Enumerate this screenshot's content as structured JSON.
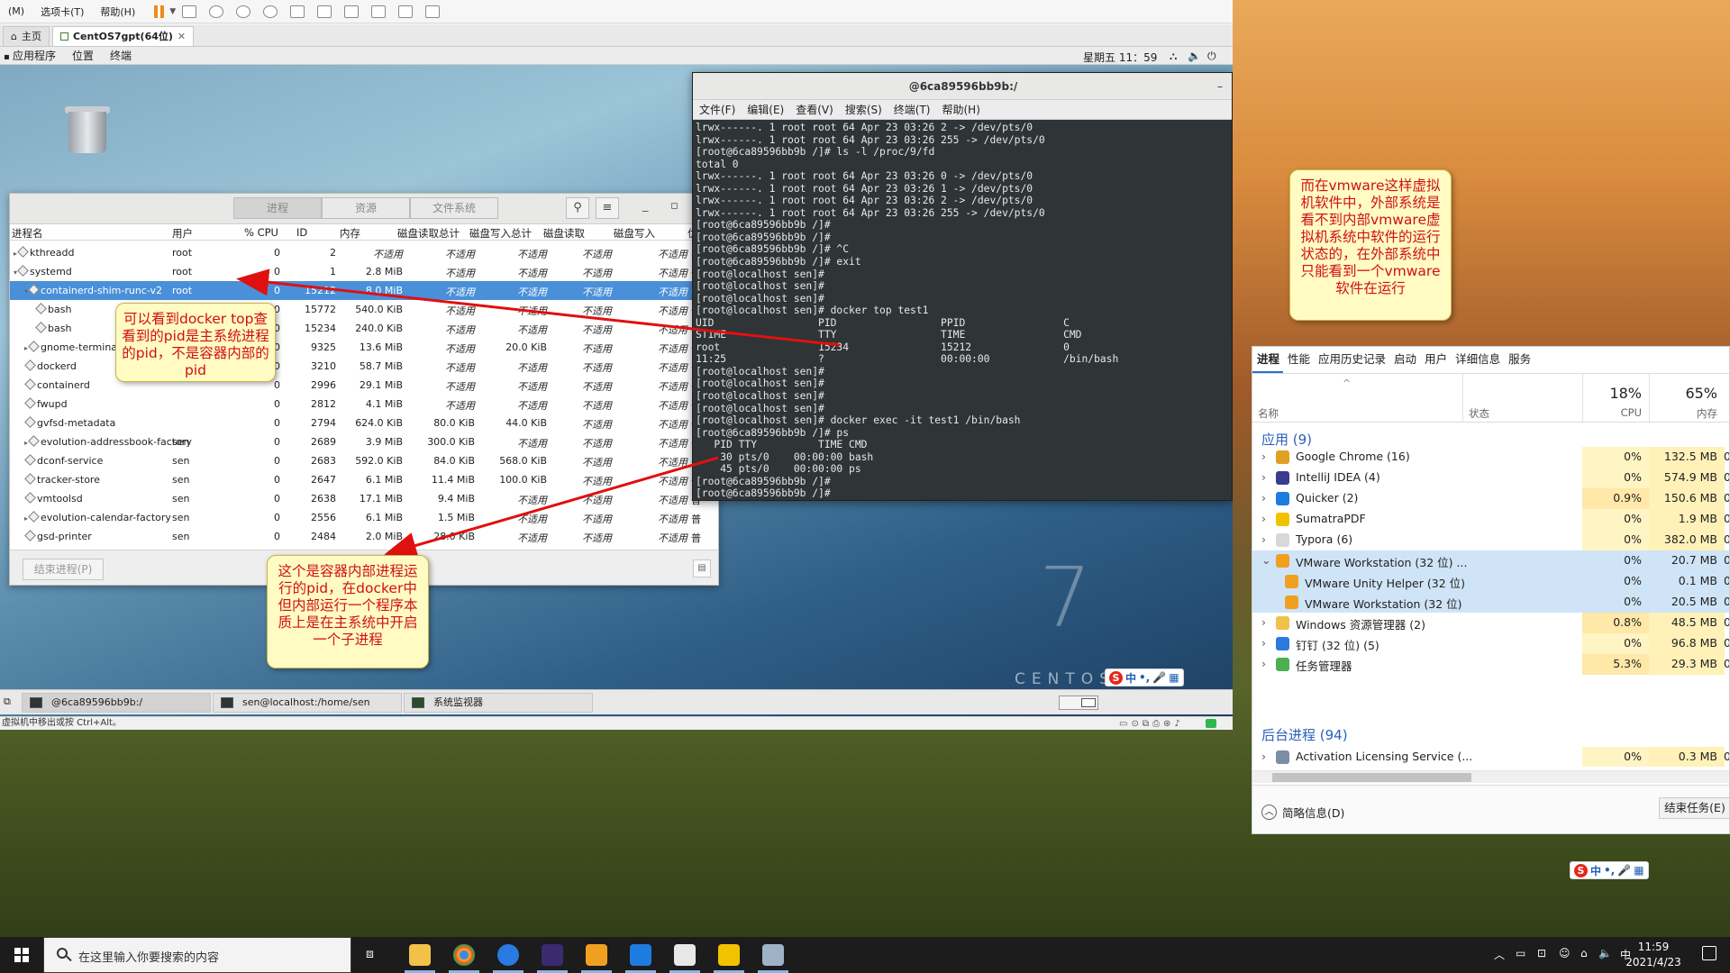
{
  "vmware": {
    "menu": [
      "(M)",
      "选项卡(T)",
      "帮助(H)"
    ],
    "tabs": [
      {
        "label": "主页",
        "active": false
      },
      {
        "label": "CentOS7gpt(64位)",
        "active": true
      }
    ],
    "status_hint": "虚拟机中移出或按 Ctrl+Alt。"
  },
  "gnome": {
    "menu": [
      "应用程序",
      "位置",
      "终端"
    ],
    "clock": "星期五 11：59",
    "desktop_logo": {
      "number": "7",
      "name": "CENTOS"
    },
    "taskbar": [
      {
        "label": "@6ca89596bb9b:/",
        "active": true
      },
      {
        "label": "sen@localhost:/home/sen",
        "active": false
      },
      {
        "label": "系统监视器",
        "active": false
      }
    ],
    "ime": "中"
  },
  "sysmon": {
    "tabs": [
      "进程",
      "资源",
      "文件系统"
    ],
    "active_tab": "进程",
    "columns": [
      "进程名",
      "用户",
      "% CPU",
      "ID",
      "内存",
      "磁盘读取总计",
      "磁盘写入总计",
      "磁盘读取",
      "磁盘写入",
      "优"
    ],
    "rows": [
      {
        "name": "kthreadd",
        "user": "root",
        "cpu": "0",
        "id": "2",
        "mem": "不适用",
        "rt": "不适用",
        "wt": "不适用",
        "r": "不适用",
        "w": "不适用",
        "p": "非",
        "indent": 0,
        "twisty": "▸",
        "sel": false
      },
      {
        "name": "systemd",
        "user": "root",
        "cpu": "0",
        "id": "1",
        "mem": "2.8 MiB",
        "rt": "不适用",
        "wt": "不适用",
        "r": "不适用",
        "w": "不适用",
        "p": "普",
        "indent": 0,
        "twisty": "▾",
        "sel": false
      },
      {
        "name": "containerd-shim-runc-v2",
        "user": "root",
        "cpu": "0",
        "id": "15212",
        "mem": "8.0 MiB",
        "rt": "不适用",
        "wt": "不适用",
        "r": "不适用",
        "w": "不适用",
        "p": "普",
        "indent": 1,
        "twisty": "▾",
        "sel": true
      },
      {
        "name": "bash",
        "user": "root",
        "cpu": "0",
        "id": "15772",
        "mem": "540.0 KiB",
        "rt": "不适用",
        "wt": "不适用",
        "r": "不适用",
        "w": "不适用",
        "p": "普",
        "indent": 2,
        "twisty": "",
        "sel": false
      },
      {
        "name": "bash",
        "user": "root",
        "cpu": "0",
        "id": "15234",
        "mem": "240.0 KiB",
        "rt": "不适用",
        "wt": "不适用",
        "r": "不适用",
        "w": "不适用",
        "p": "普",
        "indent": 2,
        "twisty": "",
        "sel": false
      },
      {
        "name": "gnome-terminal",
        "user": "",
        "cpu": "0",
        "id": "9325",
        "mem": "13.6 MiB",
        "rt": "不适用",
        "wt": "20.0 KiB",
        "r": "不适用",
        "w": "不适用",
        "p": "普",
        "indent": 1,
        "twisty": "▸",
        "sel": false
      },
      {
        "name": "dockerd",
        "user": "",
        "cpu": "0",
        "id": "3210",
        "mem": "58.7 MiB",
        "rt": "不适用",
        "wt": "不适用",
        "r": "不适用",
        "w": "不适用",
        "p": "普",
        "indent": 1,
        "twisty": "",
        "sel": false
      },
      {
        "name": "containerd",
        "user": "",
        "cpu": "0",
        "id": "2996",
        "mem": "29.1 MiB",
        "rt": "不适用",
        "wt": "不适用",
        "r": "不适用",
        "w": "不适用",
        "p": "普",
        "indent": 1,
        "twisty": "",
        "sel": false
      },
      {
        "name": "fwupd",
        "user": "",
        "cpu": "0",
        "id": "2812",
        "mem": "4.1 MiB",
        "rt": "不适用",
        "wt": "不适用",
        "r": "不适用",
        "w": "不适用",
        "p": "普",
        "indent": 1,
        "twisty": "",
        "sel": false
      },
      {
        "name": "gvfsd-metadata",
        "user": "",
        "cpu": "0",
        "id": "2794",
        "mem": "624.0 KiB",
        "rt": "80.0 KiB",
        "wt": "44.0 KiB",
        "r": "不适用",
        "w": "不适用",
        "p": "普",
        "indent": 1,
        "twisty": "",
        "sel": false
      },
      {
        "name": "evolution-addressbook-factory",
        "user": "sen",
        "cpu": "0",
        "id": "2689",
        "mem": "3.9 MiB",
        "rt": "300.0 KiB",
        "wt": "不适用",
        "r": "不适用",
        "w": "不适用",
        "p": "普",
        "indent": 1,
        "twisty": "▸",
        "sel": false
      },
      {
        "name": "dconf-service",
        "user": "sen",
        "cpu": "0",
        "id": "2683",
        "mem": "592.0 KiB",
        "rt": "84.0 KiB",
        "wt": "568.0 KiB",
        "r": "不适用",
        "w": "不适用",
        "p": "普",
        "indent": 1,
        "twisty": "",
        "sel": false
      },
      {
        "name": "tracker-store",
        "user": "sen",
        "cpu": "0",
        "id": "2647",
        "mem": "6.1 MiB",
        "rt": "11.4 MiB",
        "wt": "100.0 KiB",
        "r": "不适用",
        "w": "不适用",
        "p": "普",
        "indent": 1,
        "twisty": "",
        "sel": false
      },
      {
        "name": "vmtoolsd",
        "user": "sen",
        "cpu": "0",
        "id": "2638",
        "mem": "17.1 MiB",
        "rt": "9.4 MiB",
        "wt": "不适用",
        "r": "不适用",
        "w": "不适用",
        "p": "普",
        "indent": 1,
        "twisty": "",
        "sel": false
      },
      {
        "name": "evolution-calendar-factory",
        "user": "sen",
        "cpu": "0",
        "id": "2556",
        "mem": "6.1 MiB",
        "rt": "1.5 MiB",
        "wt": "不适用",
        "r": "不适用",
        "w": "不适用",
        "p": "普",
        "indent": 1,
        "twisty": "▸",
        "sel": false
      },
      {
        "name": "gsd-printer",
        "user": "sen",
        "cpu": "0",
        "id": "2484",
        "mem": "2.0 MiB",
        "rt": "28.0 KiB",
        "wt": "不适用",
        "r": "不适用",
        "w": "不适用",
        "p": "普",
        "indent": 1,
        "twisty": "",
        "sel": false
      }
    ],
    "end_process": "结束进程(P)"
  },
  "terminal": {
    "title": "@6ca89596bb9b:/",
    "menu": [
      "文件(F)",
      "编辑(E)",
      "查看(V)",
      "搜索(S)",
      "终端(T)",
      "帮助(H)"
    ],
    "lines": [
      "lrwx------. 1 root root 64 Apr 23 03:26 2 -> /dev/pts/0",
      "lrwx------. 1 root root 64 Apr 23 03:26 255 -> /dev/pts/0",
      "[root@6ca89596bb9b /]# ls -l /proc/9/fd",
      "total 0",
      "lrwx------. 1 root root 64 Apr 23 03:26 0 -> /dev/pts/0",
      "lrwx------. 1 root root 64 Apr 23 03:26 1 -> /dev/pts/0",
      "lrwx------. 1 root root 64 Apr 23 03:26 2 -> /dev/pts/0",
      "lrwx------. 1 root root 64 Apr 23 03:26 255 -> /dev/pts/0",
      "[root@6ca89596bb9b /]#",
      "[root@6ca89596bb9b /]#",
      "[root@6ca89596bb9b /]# ^C",
      "[root@6ca89596bb9b /]# exit",
      "[root@localhost sen]#",
      "[root@localhost sen]#",
      "[root@localhost sen]#",
      "[root@localhost sen]# docker top test1",
      "UID                 PID                 PPID                C",
      "STIME               TTY                 TIME                CMD",
      "root                15234               15212               0",
      "11:25               ?                   00:00:00            /bin/bash",
      "[root@localhost sen]#",
      "[root@localhost sen]#",
      "[root@localhost sen]#",
      "[root@localhost sen]#",
      "[root@localhost sen]# docker exec -it test1 /bin/bash",
      "[root@6ca89596bb9b /]# ps",
      "   PID TTY          TIME CMD",
      "    30 pts/0    00:00:00 bash",
      "    45 pts/0    00:00:00 ps",
      "[root@6ca89596bb9b /]#",
      "[root@6ca89596bb9b /]#"
    ]
  },
  "annotations": {
    "docker_top": "可以看到docker top查看到的pid是主系统进程的pid，不是容器内部的pid",
    "container_pid": "这个是容器内部进程运行的pid，在docker中但内部运行一个程序本质上是在主系统中开启一个子进程",
    "vmware_note": "而在vmware这样虚拟机软件中，外部系统是看不到内部vmware虚拟机系统中软件的运行状态的，在外部系统中只能看到一个vmware软件在运行"
  },
  "taskmgr": {
    "tabs": [
      "进程",
      "性能",
      "应用历史记录",
      "启动",
      "用户",
      "详细信息",
      "服务"
    ],
    "active_tab": "进程",
    "col_name": "名称",
    "col_status": "状态",
    "cpu_total": "18%",
    "cpu_label": "CPU",
    "mem_total": "65%",
    "mem_label": "内存",
    "apps_group": "应用 (9)",
    "background_group": "后台进程 (94)",
    "rows": [
      {
        "name": "Google Chrome (16)",
        "cpu": "0%",
        "mem": "132.5 MB",
        "disk": "0",
        "chev": "›",
        "indent": 0,
        "sel": false,
        "icon": "#e0a020"
      },
      {
        "name": "IntelliJ IDEA (4)",
        "cpu": "0%",
        "mem": "574.9 MB",
        "disk": "0",
        "chev": "›",
        "indent": 0,
        "sel": false,
        "icon": "#3b3b8f"
      },
      {
        "name": "Quicker (2)",
        "cpu": "0.9%",
        "mem": "150.6 MB",
        "disk": "0",
        "chev": "›",
        "indent": 0,
        "sel": false,
        "icon": "#1e7be0"
      },
      {
        "name": "SumatraPDF",
        "cpu": "0%",
        "mem": "1.9 MB",
        "disk": "0",
        "chev": "›",
        "indent": 0,
        "sel": false,
        "icon": "#f2c200"
      },
      {
        "name": "Typora (6)",
        "cpu": "0%",
        "mem": "382.0 MB",
        "disk": "0",
        "chev": "›",
        "indent": 0,
        "sel": false,
        "icon": "#d8d8d8"
      },
      {
        "name": "VMware Workstation (32 位) ...",
        "cpu": "0%",
        "mem": "20.7 MB",
        "disk": "0",
        "chev": "⌄",
        "indent": 0,
        "sel": true,
        "icon": "#f0a020"
      },
      {
        "name": "VMware Unity Helper (32 位)",
        "cpu": "0%",
        "mem": "0.1 MB",
        "disk": "0",
        "chev": "",
        "indent": 1,
        "sel": true,
        "icon": "#f0a020"
      },
      {
        "name": "VMware Workstation (32 位)",
        "cpu": "0%",
        "mem": "20.5 MB",
        "disk": "0",
        "chev": "",
        "indent": 1,
        "sel": true,
        "icon": "#f0a020"
      },
      {
        "name": "Windows 资源管理器 (2)",
        "cpu": "0.8%",
        "mem": "48.5 MB",
        "disk": "0",
        "chev": "›",
        "indent": 0,
        "sel": false,
        "icon": "#f2c14a"
      },
      {
        "name": "钉钉 (32 位) (5)",
        "cpu": "0%",
        "mem": "96.8 MB",
        "disk": "0",
        "chev": "›",
        "indent": 0,
        "sel": false,
        "icon": "#2a7ae2"
      },
      {
        "name": "任务管理器",
        "cpu": "5.3%",
        "mem": "29.3 MB",
        "disk": "0",
        "chev": "›",
        "indent": 0,
        "sel": false,
        "icon": "#4caf50"
      },
      {
        "name": "Activation Licensing Service (...",
        "cpu": "0%",
        "mem": "0.3 MB",
        "disk": "0",
        "chev": "›",
        "indent": 0,
        "sel": false,
        "icon": "#7a8fa6"
      }
    ],
    "fewer_details": "简略信息(D)",
    "end_task": "结束任务(E)"
  },
  "windows": {
    "search_placeholder": "在这里输入你要搜索的内容",
    "time": "11:59",
    "date": "2021/4/23",
    "ime": "中"
  }
}
